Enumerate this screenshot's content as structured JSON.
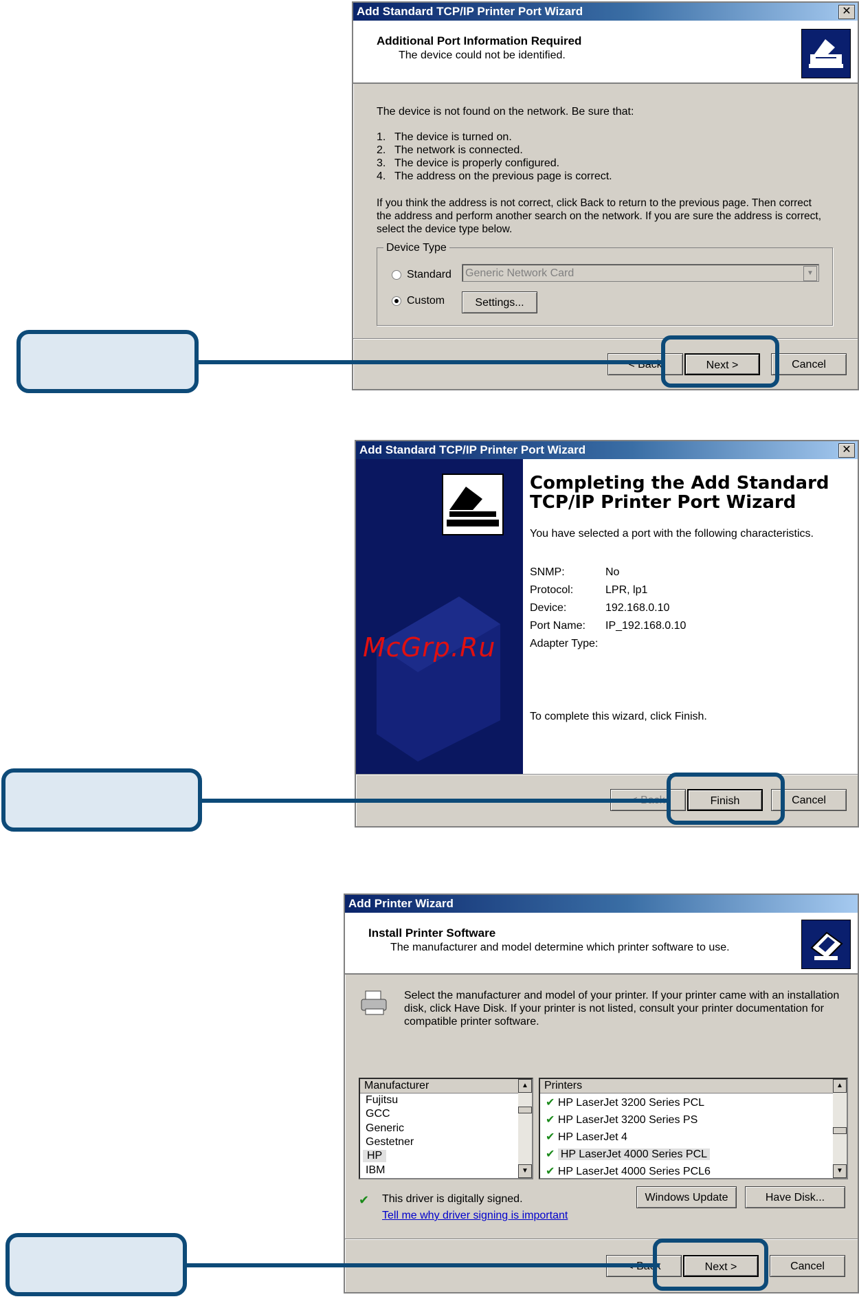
{
  "dialog1": {
    "title": "Add Standard TCP/IP Printer Port Wizard",
    "close": "✕",
    "header_title": "Additional Port Information Required",
    "header_sub": "The device could not be identified.",
    "intro": "The device is not found on the network.  Be sure that:",
    "items": [
      {
        "num": "1.",
        "text": "The device is turned on."
      },
      {
        "num": "2.",
        "text": "The network is connected."
      },
      {
        "num": "3.",
        "text": "The device is properly configured."
      },
      {
        "num": "4.",
        "text": "The address on the previous page is correct."
      }
    ],
    "para": [
      "If you think the address is not correct, click Back to return to the previous page.  Then correct",
      "the address and perform another search on the network.  If you are sure the address is correct,",
      "select the device type below."
    ],
    "device_type_label": "Device Type",
    "standard_label": "Standard",
    "custom_label": "Custom",
    "combo_value": "Generic Network Card",
    "settings_label": "Settings...",
    "back_label": "< Back",
    "next_label": "Next >",
    "cancel_label": "Cancel"
  },
  "dialog2": {
    "title": "Add Standard TCP/IP Printer Port Wizard",
    "close": "✕",
    "heading_line1": "Completing the Add Standard",
    "heading_line2": "TCP/IP Printer Port Wizard",
    "subtitle": "You have selected a port with the following characteristics.",
    "fields": [
      {
        "label": "SNMP:",
        "value": "No"
      },
      {
        "label": "Protocol:",
        "value": "LPR, lp1"
      },
      {
        "label": "Device:",
        "value": "192.168.0.10"
      },
      {
        "label": "Port Name:",
        "value": "IP_192.168.0.10"
      },
      {
        "label": "Adapter Type:",
        "value": ""
      }
    ],
    "complete_text": "To complete this wizard, click Finish.",
    "watermark": "McGrp.Ru",
    "back_label": "< Back",
    "finish_label": "Finish",
    "cancel_label": "Cancel"
  },
  "dialog3": {
    "title": "Add Printer Wizard",
    "header_title": "Install Printer Software",
    "header_sub": "The manufacturer and model determine which printer software to use.",
    "instructions": [
      "Select the manufacturer and model of your printer. If your printer came with an installation",
      "disk, click Have Disk. If your printer is not listed, consult your printer documentation for",
      "compatible printer software."
    ],
    "manufacturer_header": "Manufacturer",
    "manufacturers": [
      "Fujitsu",
      "GCC",
      "Generic",
      "Gestetner",
      "HP",
      "IBM"
    ],
    "selected_manufacturer": "HP",
    "printers_header": "Printers",
    "printers": [
      "HP LaserJet 3200 Series PCL",
      "HP LaserJet 3200 Series PS",
      "HP LaserJet 4",
      "HP LaserJet 4000 Series PCL",
      "HP LaserJet 4000 Series PCL6"
    ],
    "selected_printer": "HP LaserJet 4000 Series PCL",
    "signed_text": "This driver is digitally signed.",
    "signing_link": "Tell me why driver signing is important",
    "windows_update_label": "Windows Update",
    "have_disk_label": "Have Disk...",
    "back_label": "< Back",
    "next_label": "Next >",
    "cancel_label": "Cancel"
  },
  "colors": {
    "callout_border": "#0d4a78",
    "callout_fill": "#dde8f2",
    "titlebar_start": "#0a246a",
    "dialog_bg": "#d4d0c8"
  }
}
